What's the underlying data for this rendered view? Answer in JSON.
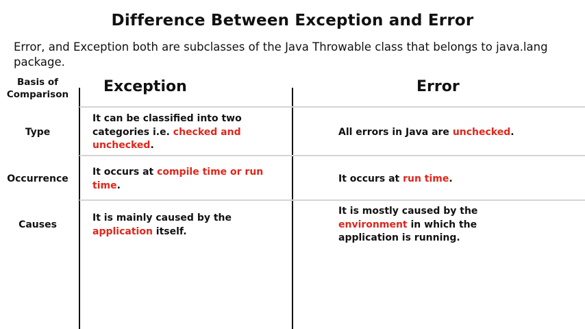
{
  "title": "Difference Between Exception and Error",
  "intro": "Error, and Exception both are subclasses of the Java Throwable class that belongs to java.lang package.",
  "header": {
    "basis_line1": "Basis of",
    "basis_line2": "Comparison",
    "exception": "Exception",
    "error": "Error"
  },
  "rows": [
    {
      "label": "Type",
      "exception": {
        "pre": "It can be classified into two categories i.e. ",
        "hl": "checked and unchecked",
        "post": "."
      },
      "error": {
        "pre": "All errors in Java are ",
        "hl": "unchecked",
        "post": "."
      }
    },
    {
      "label": "Occurrence",
      "exception": {
        "pre": "It occurs at ",
        "hl": "compile time or run time",
        "post": "."
      },
      "error": {
        "pre": "It occurs at ",
        "hl": "run time",
        "post": "."
      }
    },
    {
      "label": "Causes",
      "exception": {
        "pre": "It is mainly caused by the ",
        "hl": "application",
        "post": " itself."
      },
      "error": {
        "pre": "It is mostly caused by the ",
        "hl": "environment",
        "post": " in which the application is running."
      }
    }
  ],
  "colors": {
    "highlight": "#e0261b",
    "text": "#111111",
    "divider": "#d4d4d4"
  }
}
